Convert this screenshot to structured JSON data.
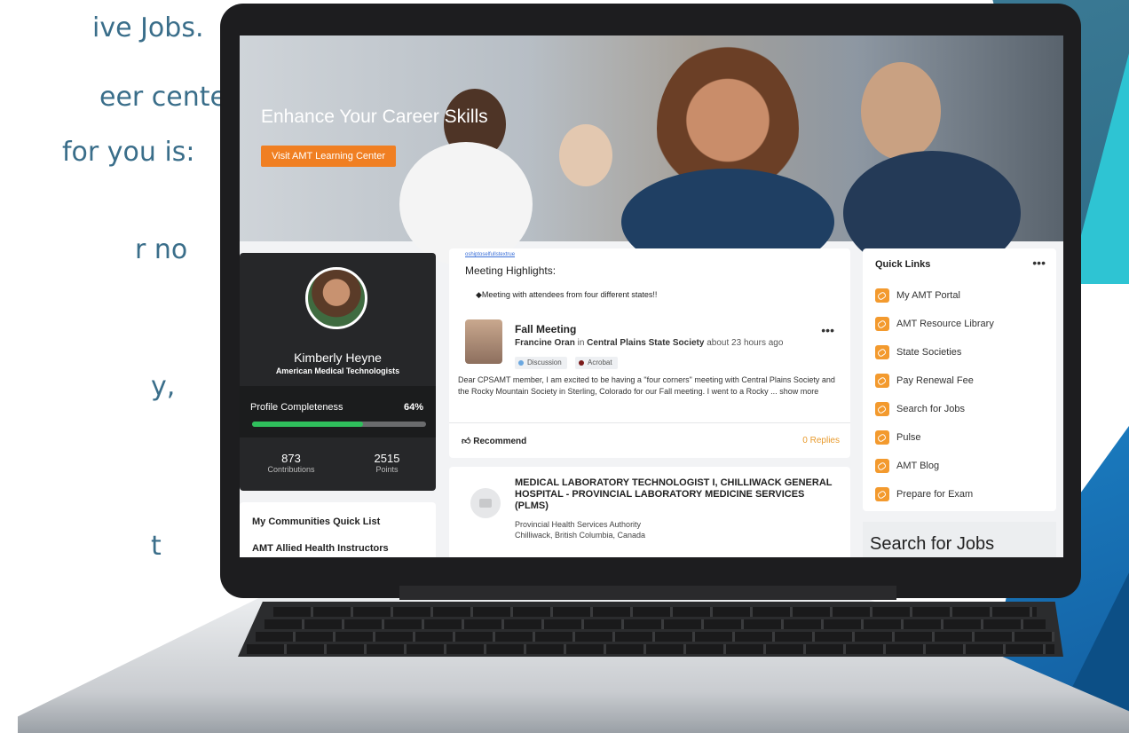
{
  "side_text": [
    "ive Jobs.",
    "eer center",
    "for you is:",
    "r no",
    "y,",
    "t"
  ],
  "hero": {
    "title": "Enhance Your Career Skills",
    "button": "Visit AMT Learning Center"
  },
  "profile": {
    "name": "Kimberly Heyne",
    "org": "American Medical Technologists",
    "completeness_label": "Profile Completeness",
    "completeness_value": "64%",
    "completeness_fraction": 0.64,
    "contributions_value": "873",
    "contributions_label": "Contributions",
    "points_value": "2515",
    "points_label": "Points"
  },
  "communities": {
    "title": "My Communities Quick List",
    "items": [
      "AMT Allied Health Instructors"
    ]
  },
  "feed": {
    "link_text": "oshiptoselfullstextrue",
    "meeting_highlights": "Meeting Highlights:",
    "bullet": "◆Meeting with attendees from four different states!!",
    "post": {
      "title": "Fall Meeting",
      "author": "Francine Oran",
      "in_word": "in",
      "community": "Central Plains State Society",
      "time": "about 23 hours ago",
      "tags": [
        "Discussion",
        "Acrobat"
      ],
      "body": "Dear CPSAMT member, I am excited to be having a \"four corners\" meeting with Central Plains Society and the Rocky Mountain Society in Sterling, Colorado for our Fall meeting. I went to a Rocky ...",
      "show_more": "show more",
      "recommend": "Recommend",
      "replies": "0 Replies"
    },
    "job": {
      "title": "MEDICAL LABORATORY TECHNOLOGIST I, CHILLIWACK GENERAL HOSPITAL - PROVINCIAL LABORATORY MEDICINE SERVICES (PLMS)",
      "org": "Provincial Health Services Authority",
      "location": "Chilliwack, British Columbia, Canada"
    }
  },
  "quick_links": {
    "title": "Quick Links",
    "items": [
      "My AMT Portal",
      "AMT Resource Library",
      "State Societies",
      "Pay Renewal Fee",
      "Search for Jobs",
      "Pulse",
      "AMT Blog",
      "Prepare for Exam"
    ]
  },
  "search_jobs": {
    "title": "Search for Jobs"
  },
  "colors": {
    "accent_orange": "#f07f22",
    "progress_green": "#2fbf5c",
    "quick_link_icon": "#f39a2e"
  }
}
